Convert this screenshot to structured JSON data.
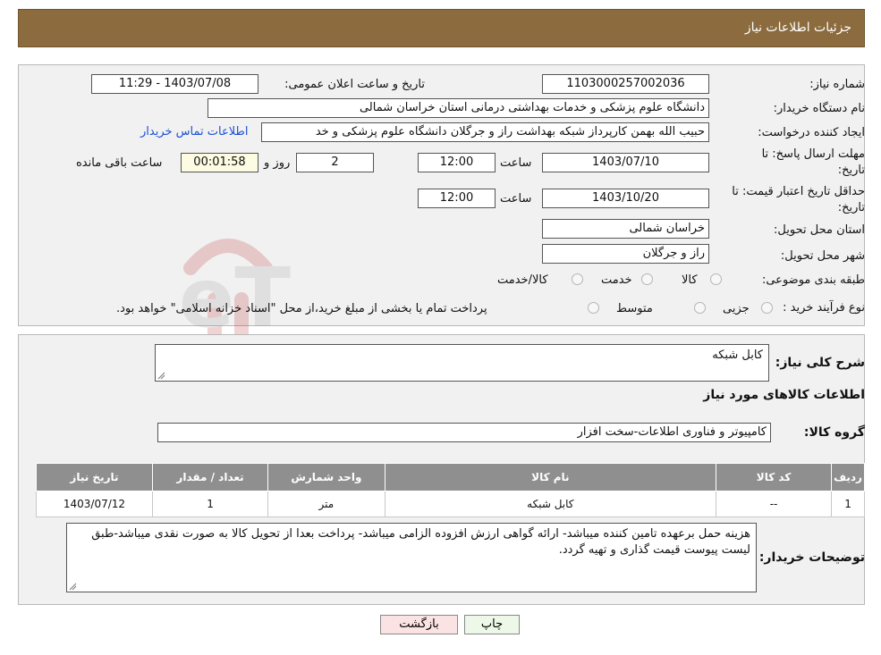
{
  "header": {
    "title": "جزئیات اطلاعات نیاز"
  },
  "watermark": {
    "text": "AriaTender.neT"
  },
  "fields": {
    "need_number_label": "شماره نیاز:",
    "need_number": "1103000257002036",
    "announce_label": "تاریخ و ساعت اعلان عمومی:",
    "announce_value": "1403/07/08 - 11:29",
    "buyer_org_label": "نام دستگاه خریدار:",
    "buyer_org": "دانشگاه علوم پزشکی و خدمات بهداشتی درمانی استان خراسان شمالی",
    "creator_label": "ایجاد کننده درخواست:",
    "creator": "حبیب الله بهمن کارپرداز شبکه بهداشت راز و جرگلان دانشگاه علوم پزشکی و خد",
    "contact_link": "اطلاعات تماس خریدار",
    "deadline_label_1": "مهلت ارسال پاسخ: تا",
    "deadline_label_2": "تاریخ:",
    "deadline_date": "1403/07/10",
    "time_label": "ساعت",
    "deadline_time": "12:00",
    "days_value": "2",
    "days_label": "روز و",
    "remaining_time": "00:01:58",
    "remaining_label": "ساعت باقی مانده",
    "validity_label_1": "حداقل تاریخ اعتبار قیمت: تا",
    "validity_label_2": "تاریخ:",
    "validity_date": "1403/10/20",
    "validity_time": "12:00",
    "province_label": "استان محل تحویل:",
    "province": "خراسان شمالی",
    "city_label": "شهر محل تحویل:",
    "city": "راز و جرگلان",
    "category_label": "طبقه بندی موضوعی:",
    "category_options": [
      "کالا",
      "خدمت",
      "کالا/خدمت"
    ],
    "process_label": "نوع فرآیند خرید :",
    "process_options": [
      "جزیی",
      "متوسط"
    ],
    "process_note": "پرداخت تمام یا بخشی از مبلغ خرید،از محل \"اسناد خزانه اسلامی\" خواهد بود."
  },
  "summary": {
    "label": "شرح کلی نیاز:",
    "value": "کابل شبکه",
    "goods_section_title": "اطلاعات کالاهای مورد نیاز",
    "group_label": "گروه کالا:",
    "group_value": "کامپیوتر و فناوری اطلاعات-سخت افزار"
  },
  "table": {
    "headers": [
      "ردیف",
      "کد کالا",
      "نام کالا",
      "واحد شمارش",
      "تعداد / مقدار",
      "تاریخ نیاز"
    ],
    "rows": [
      [
        "1",
        "--",
        "کابل شبکه",
        "متر",
        "1",
        "1403/07/12"
      ]
    ]
  },
  "notes": {
    "label": "توضیحات خریدار:",
    "value": "هزینه حمل برعهده تامین کننده میباشد- ارائه گواهی ارزش افزوده الزامی میباشد- پرداخت بعدا از تحویل کالا به صورت نقدی میباشد-طبق لیست پیوست قیمت گذاری و تهیه گردد."
  },
  "buttons": {
    "print": "چاپ",
    "back": "بازگشت"
  }
}
